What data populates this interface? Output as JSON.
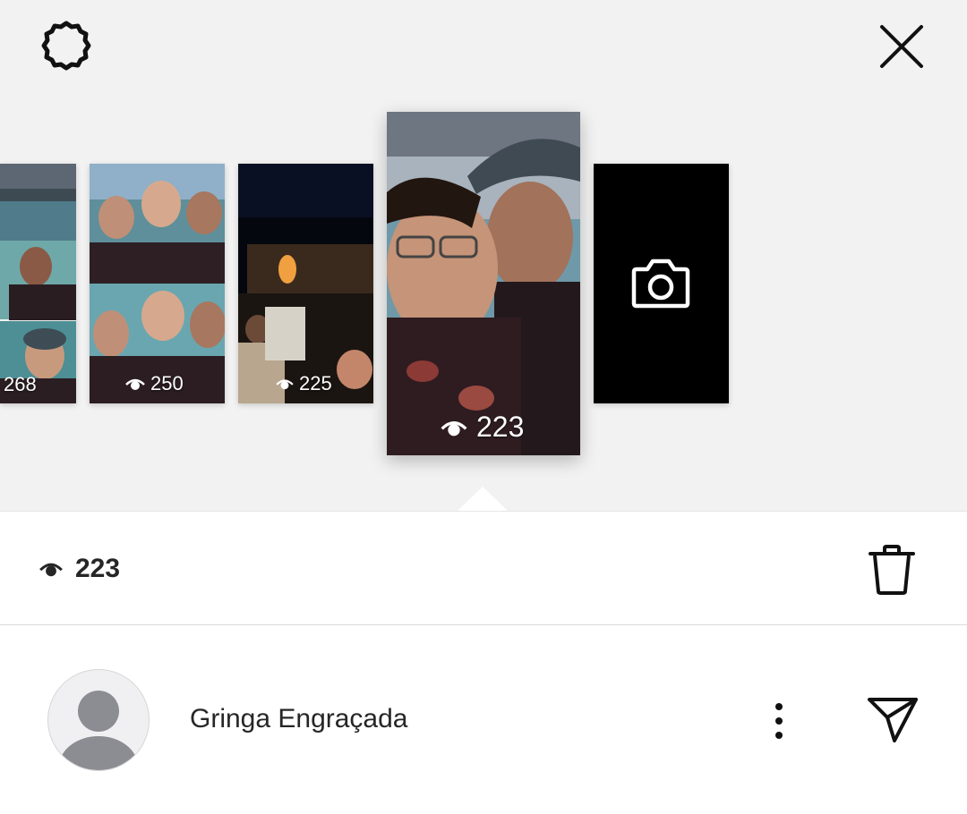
{
  "header": {
    "settings_icon": "settings-gear-icon",
    "close_icon": "close-icon"
  },
  "stories": [
    {
      "views": "268",
      "kind": "photo-boat-selfies"
    },
    {
      "views": "250",
      "kind": "photo-group-selfie"
    },
    {
      "views": "225",
      "kind": "photo-night-crowd"
    },
    {
      "views": "223",
      "kind": "photo-selfie-selected",
      "selected": true
    },
    {
      "views": "",
      "kind": "add-story-camera"
    }
  ],
  "selected_stats": {
    "views": "223",
    "eye_icon": "eye-icon",
    "delete_icon": "trash-icon"
  },
  "viewers": [
    {
      "name": "Gringa Engraçada",
      "avatar": "default-avatar",
      "more_icon": "more-vertical-icon",
      "send_icon": "send-icon"
    }
  ],
  "colors": {
    "top_background": "#f2f2f2",
    "text": "#262626",
    "divider": "#dbdbdb"
  }
}
